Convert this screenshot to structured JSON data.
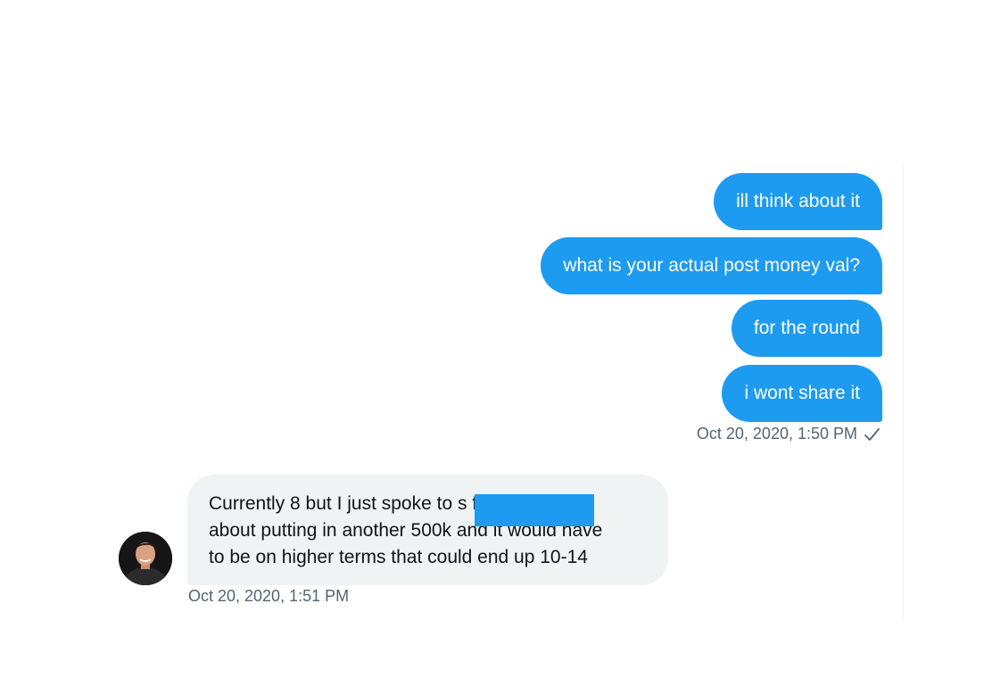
{
  "outgoing": {
    "messages": [
      "ill think about it",
      "what is your actual post money val?",
      "for the round",
      "i wont share it"
    ],
    "timestamp": "Oct 20, 2020, 1:50 PM",
    "status_icon": "checkmark-icon"
  },
  "incoming": {
    "lines": [
      "Currently 8 but I just spoke to                      s fund",
      "about putting in another 500k and it would have",
      "to be on higher terms that could end up 10-14"
    ],
    "timestamp": "Oct 20, 2020, 1:51 PM",
    "redaction_color": "#1d9bf0"
  },
  "colors": {
    "accent": "#1d9bf0",
    "incoming_bubble": "#eff3f4",
    "muted_text": "#536471"
  }
}
